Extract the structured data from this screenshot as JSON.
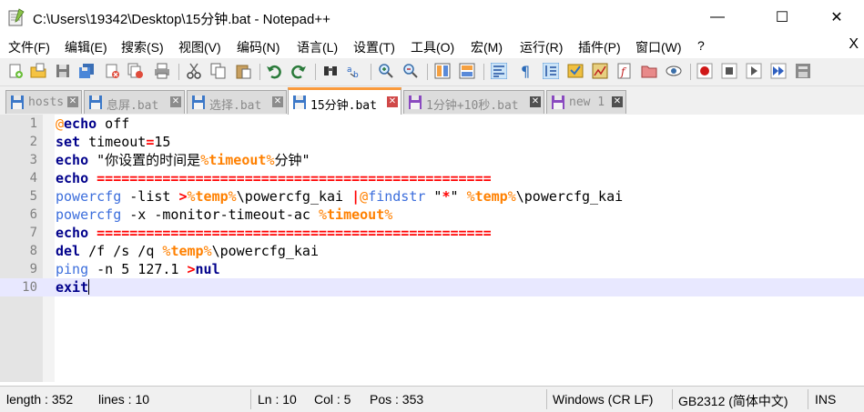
{
  "window": {
    "title": "C:\\Users\\19342\\Desktop\\15分钟.bat - Notepad++",
    "minimize": "—",
    "maximize": "☐",
    "close": "✕"
  },
  "menu": {
    "items": [
      "文件(F)",
      "编辑(E)",
      "搜索(S)",
      "视图(V)",
      "编码(N)",
      "语言(L)",
      "设置(T)",
      "工具(O)",
      "宏(M)",
      "运行(R)",
      "插件(P)",
      "窗口(W)",
      "?"
    ],
    "close_doc": "X"
  },
  "toolbar": {
    "icons": [
      "new-file-icon",
      "open-file-icon",
      "save-icon",
      "save-all-icon",
      "close-icon",
      "close-all-icon",
      "print-icon",
      "cut-icon",
      "copy-icon",
      "paste-icon",
      "undo-icon",
      "redo-icon",
      "find-icon",
      "replace-icon",
      "zoom-in-icon",
      "zoom-out-icon",
      "sync-vertical-icon",
      "sync-horizontal-icon",
      "word-wrap-icon",
      "show-all-chars-icon",
      "indent-guide-icon",
      "user-language-icon",
      "doc-map-icon",
      "function-list-icon",
      "folder-workspace-icon",
      "monitoring-icon",
      "record-macro-icon",
      "stop-macro-icon",
      "play-macro-icon",
      "run-macro-multiple-icon",
      "save-macro-icon"
    ]
  },
  "tabs": [
    {
      "label": "hosts",
      "active": false
    },
    {
      "label": "息屏.bat",
      "active": false
    },
    {
      "label": "选择.bat",
      "active": false
    },
    {
      "label": "15分钟.bat",
      "active": true
    },
    {
      "label": "1分钟+10秒.bat",
      "active": false
    },
    {
      "label": "new 1",
      "active": false
    }
  ],
  "editor": {
    "line_numbers": [
      "1",
      "2",
      "3",
      "4",
      "5",
      "6",
      "7",
      "8",
      "9",
      "10"
    ],
    "lines": [
      "@echo off",
      "set timeout=15",
      "echo \"你设置的时间是%timeout%分钟\"",
      "echo ================================================",
      "powercfg -list >%temp%\\powercfg_kai |@findstr \"*\" %temp%\\powercfg_kai",
      "powercfg -x -monitor-timeout-ac %timeout%",
      "echo ================================================",
      "del /f /s /q %temp%\\powercfg_kai",
      "ping -n 5 127.1 >nul",
      "exit"
    ],
    "current_line": 10
  },
  "status": {
    "length": "length : 352",
    "lines": "lines : 10",
    "ln": "Ln : 10",
    "col": "Col : 5",
    "pos": "Pos : 353",
    "eol": "Windows (CR LF)",
    "encoding": "GB2312 (简体中文)",
    "mode": "INS"
  },
  "colors": {
    "keyword": "#00008b",
    "variable": "#ff8000",
    "operator": "#ff0000",
    "external_command": "#3c6edc",
    "active_tab_accent": "#fa9a3c",
    "current_line_bg": "#e8e8ff"
  }
}
